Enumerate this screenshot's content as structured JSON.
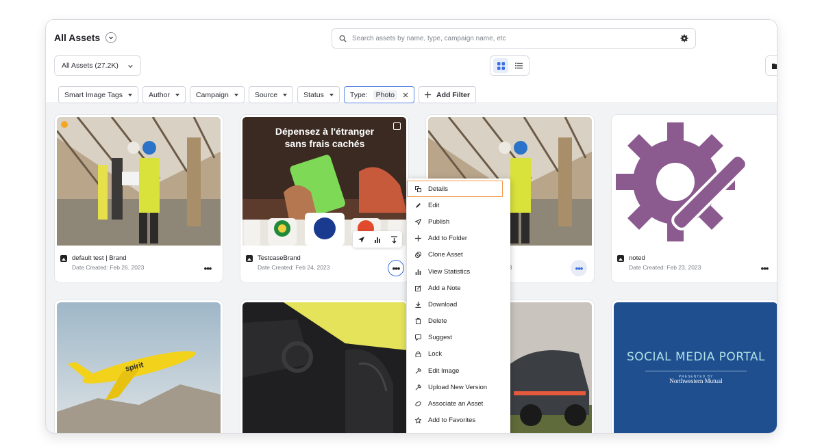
{
  "header": {
    "title": "All Assets",
    "search_placeholder": "Search assets by name, type, campaign name, etc",
    "scope_select": "All Assets (27.2K)",
    "view_modes": [
      "grid-icon",
      "list-icon"
    ]
  },
  "filters": [
    {
      "label": "Smart Image Tags"
    },
    {
      "label": "Author"
    },
    {
      "label": "Campaign"
    },
    {
      "label": "Source"
    },
    {
      "label": "Status"
    }
  ],
  "active_filter": {
    "label": "Type:",
    "value": "Photo"
  },
  "add_filter_label": "Add Filter",
  "assets": [
    {
      "title": "default test | Brand",
      "date": "Date Created: Feb 26, 2023"
    },
    {
      "title": "TestcaseBrand",
      "date": "Date Created: Feb 24, 2023",
      "promo_line1": "Dépensez à l'étranger",
      "promo_line2": "sans frais cachés"
    },
    {
      "title_suffix": ":",
      "date_suffix": "23"
    },
    {
      "title": "noted",
      "date": "Date Created: Feb 23, 2023"
    },
    {
      "title": ""
    },
    {
      "title": ""
    },
    {
      "title": ""
    },
    {
      "title": "",
      "portal_line": "SOCIAL MEDIA PORTAL",
      "portal_presented": "PRESENTED BY",
      "portal_brand": "Northwestern Mutual"
    }
  ],
  "context_menu": [
    {
      "label": "Details",
      "icon": "details-icon"
    },
    {
      "label": "Edit",
      "icon": "pencil-icon"
    },
    {
      "label": "Publish",
      "icon": "send-icon"
    },
    {
      "label": "Add to Folder",
      "icon": "plus-icon"
    },
    {
      "label": "Clone Asset",
      "icon": "clone-icon"
    },
    {
      "label": "View Statistics",
      "icon": "statistics-icon"
    },
    {
      "label": "Add a Note",
      "icon": "note-icon"
    },
    {
      "label": "Download",
      "icon": "download-icon"
    },
    {
      "label": "Delete",
      "icon": "trash-icon"
    },
    {
      "label": "Suggest",
      "icon": "suggest-icon"
    },
    {
      "label": "Lock",
      "icon": "lock-icon"
    },
    {
      "label": "Edit Image",
      "icon": "edit-image-icon"
    },
    {
      "label": "Upload New Version",
      "icon": "upload-icon"
    },
    {
      "label": "Associate an Asset",
      "icon": "link-icon"
    },
    {
      "label": "Add to Favorites",
      "icon": "star-icon"
    }
  ],
  "colors": {
    "accent": "#3b6fe0",
    "highlight": "#f2994a",
    "portal_bg": "#1f4f8f",
    "gear": "#8b5a8f"
  }
}
